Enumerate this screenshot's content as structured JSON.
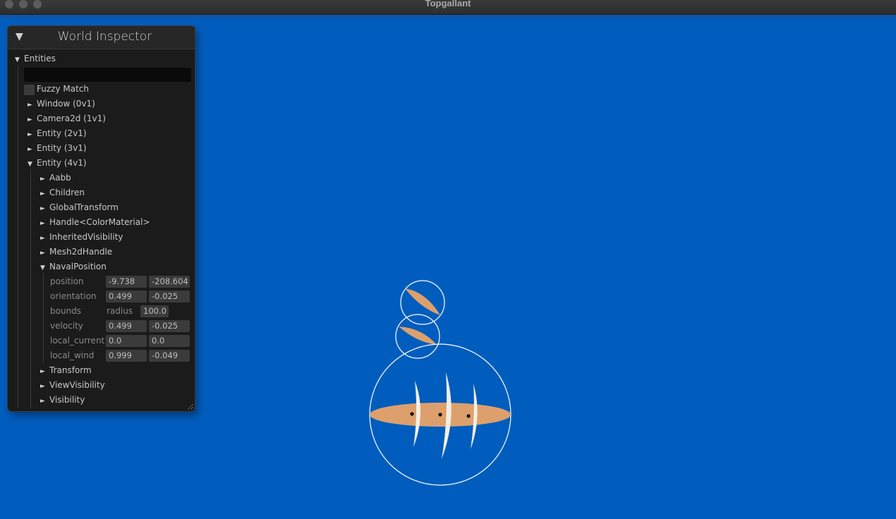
{
  "window": {
    "title": "Topgallant"
  },
  "inspector": {
    "title": "World Inspector",
    "entities_label": "Entities",
    "search_value": "",
    "fuzzy_match_label": "Fuzzy Match",
    "entities": [
      "Window (0v1)",
      "Camera2d (1v1)",
      "Entity (2v1)",
      "Entity (3v1)",
      "Entity (4v1)"
    ],
    "components": [
      "Aabb",
      "Children",
      "GlobalTransform",
      "Handle<ColorMaterial>",
      "InheritedVisibility",
      "Mesh2dHandle",
      "NavalPosition",
      "Transform",
      "ViewVisibility",
      "Visibility"
    ],
    "naval_position": {
      "position": {
        "label": "position",
        "x": "-9.738",
        "y": "-208.604"
      },
      "orientation": {
        "label": "orientation",
        "x": "0.499",
        "y": "-0.025"
      },
      "bounds": {
        "label": "bounds",
        "sub_label": "radius",
        "value": "100.0"
      },
      "velocity": {
        "label": "velocity",
        "x": "0.499",
        "y": "-0.025"
      },
      "local_current": {
        "label": "local_current",
        "x": "0.0",
        "y": "0.0"
      },
      "local_wind": {
        "label": "local_wind",
        "x": "0.999",
        "y": "-0.049"
      }
    }
  },
  "colors": {
    "background": "#005dbe",
    "hull": "#dda06c",
    "sail": "#f2efe2",
    "bounds_ring": "#ffffff"
  }
}
